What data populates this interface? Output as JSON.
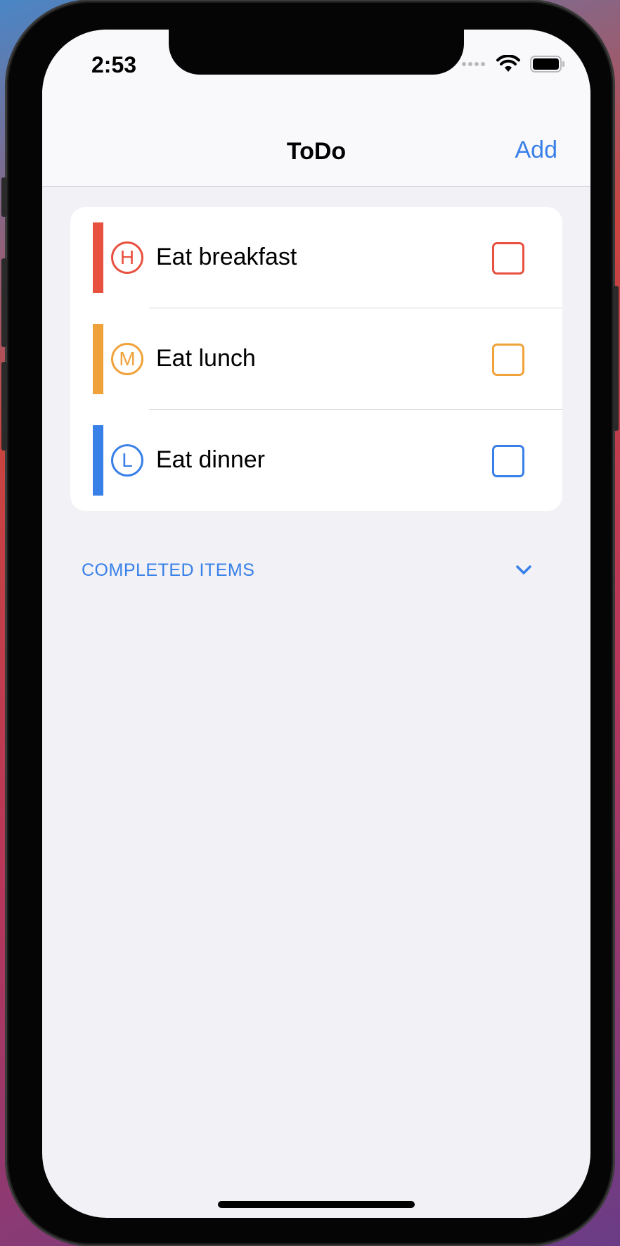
{
  "status_bar": {
    "time": "2:53"
  },
  "nav": {
    "title": "ToDo",
    "add_label": "Add"
  },
  "items": [
    {
      "priority": "H",
      "label": "Eat breakfast",
      "color": "#e8503f",
      "done": false
    },
    {
      "priority": "M",
      "label": "Eat lunch",
      "color": "#f0a23a",
      "done": false
    },
    {
      "priority": "L",
      "label": "Eat dinner",
      "color": "#3880e8",
      "done": false
    }
  ],
  "completed_section": {
    "title": "COMPLETED ITEMS",
    "icon": "chevron-down-icon",
    "expanded": false
  },
  "colors": {
    "accent": "#3880e8",
    "high": "#e8503f",
    "medium": "#f0a23a",
    "low": "#3880e8"
  }
}
